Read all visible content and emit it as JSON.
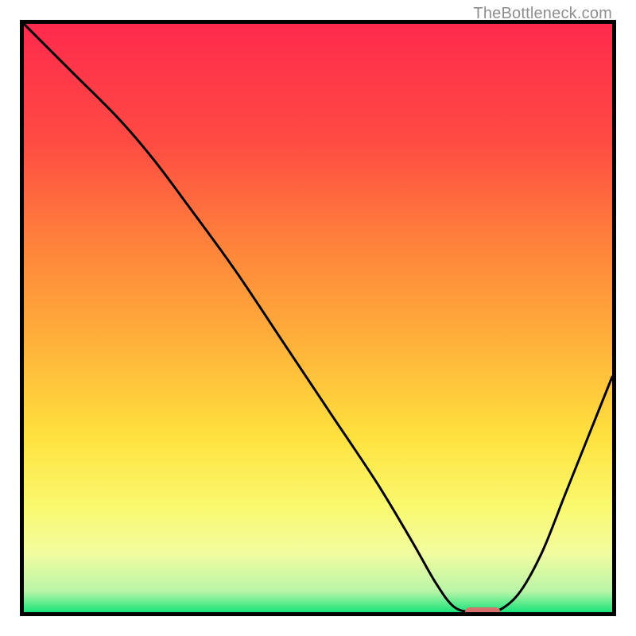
{
  "attribution": "TheBottleneck.com",
  "chart_data": {
    "type": "line",
    "title": "",
    "xlabel": "",
    "ylabel": "",
    "xlim": [
      0,
      100
    ],
    "ylim": [
      0,
      100
    ],
    "grid": false,
    "legend": false,
    "gradient_stops": [
      {
        "pos": 0.0,
        "color": "#ff2a4d"
      },
      {
        "pos": 0.2,
        "color": "#ff4b43"
      },
      {
        "pos": 0.4,
        "color": "#ff8a3a"
      },
      {
        "pos": 0.55,
        "color": "#ffb33a"
      },
      {
        "pos": 0.7,
        "color": "#ffe13e"
      },
      {
        "pos": 0.82,
        "color": "#faf96e"
      },
      {
        "pos": 0.9,
        "color": "#f2fca0"
      },
      {
        "pos": 0.965,
        "color": "#b8f5a8"
      },
      {
        "pos": 1.0,
        "color": "#19e37a"
      }
    ],
    "series": [
      {
        "name": "bottleneck-curve",
        "x": [
          0,
          8,
          16,
          22,
          28,
          36,
          44,
          52,
          60,
          66,
          70,
          73,
          76,
          80,
          84,
          88,
          92,
          96,
          100
        ],
        "y": [
          100,
          92,
          84,
          77,
          69,
          58,
          46,
          34,
          22,
          12,
          5,
          1,
          0,
          0,
          3,
          10,
          20,
          30,
          40
        ]
      }
    ],
    "marker": {
      "name": "optimal-point",
      "x_start": 75,
      "x_end": 81,
      "y": 0,
      "color": "#d6706d"
    }
  }
}
